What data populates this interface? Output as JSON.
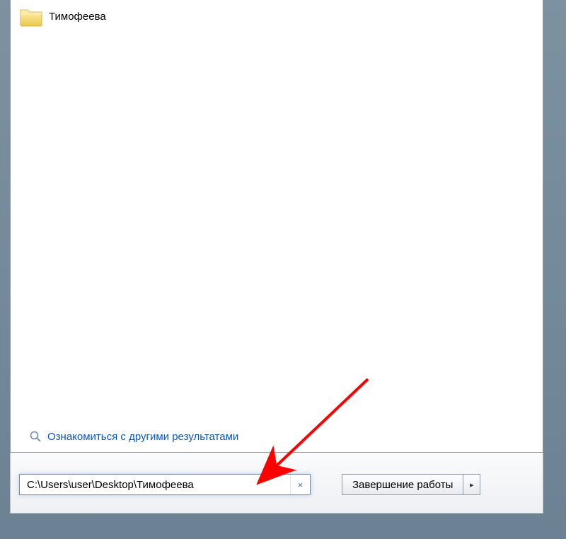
{
  "result": {
    "label": "Тимофеева"
  },
  "see_more": {
    "label": "Ознакомиться с другими результатами"
  },
  "search": {
    "value": "C:\\Users\\user\\Desktop\\Тимофеева",
    "clear": "×"
  },
  "shutdown": {
    "label": "Завершение работы",
    "arrow": "▸"
  },
  "colors": {
    "link": "#0b57c4"
  }
}
